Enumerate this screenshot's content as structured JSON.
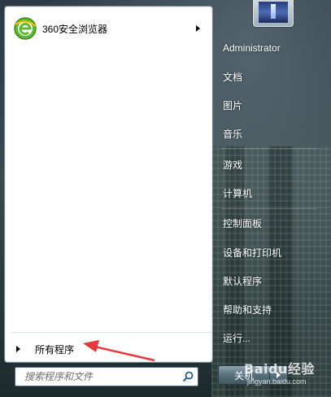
{
  "start_menu": {
    "pinned_programs": [
      {
        "label": "360安全浏览器",
        "icon": "360-browser-icon"
      }
    ],
    "all_programs_label": "所有程序",
    "search": {
      "placeholder": "搜索程序和文件"
    }
  },
  "right_pane": {
    "items": [
      {
        "label": "Administrator"
      },
      {
        "label": "文档"
      },
      {
        "label": "图片"
      },
      {
        "label": "音乐"
      },
      {
        "label": "游戏"
      },
      {
        "label": "计算机"
      },
      {
        "label": "控制面板"
      },
      {
        "label": "设备和打印机"
      },
      {
        "label": "默认程序"
      },
      {
        "label": "帮助和支持"
      },
      {
        "label": "运行..."
      }
    ],
    "shutdown_label": "关机"
  },
  "watermark": {
    "brand": "Baidu经验",
    "url": "jingyan.baidu.com"
  },
  "colors": {
    "annotation_arrow": "#e23a3a",
    "panel_background": "#ffffff",
    "right_text": "#ffffff"
  }
}
